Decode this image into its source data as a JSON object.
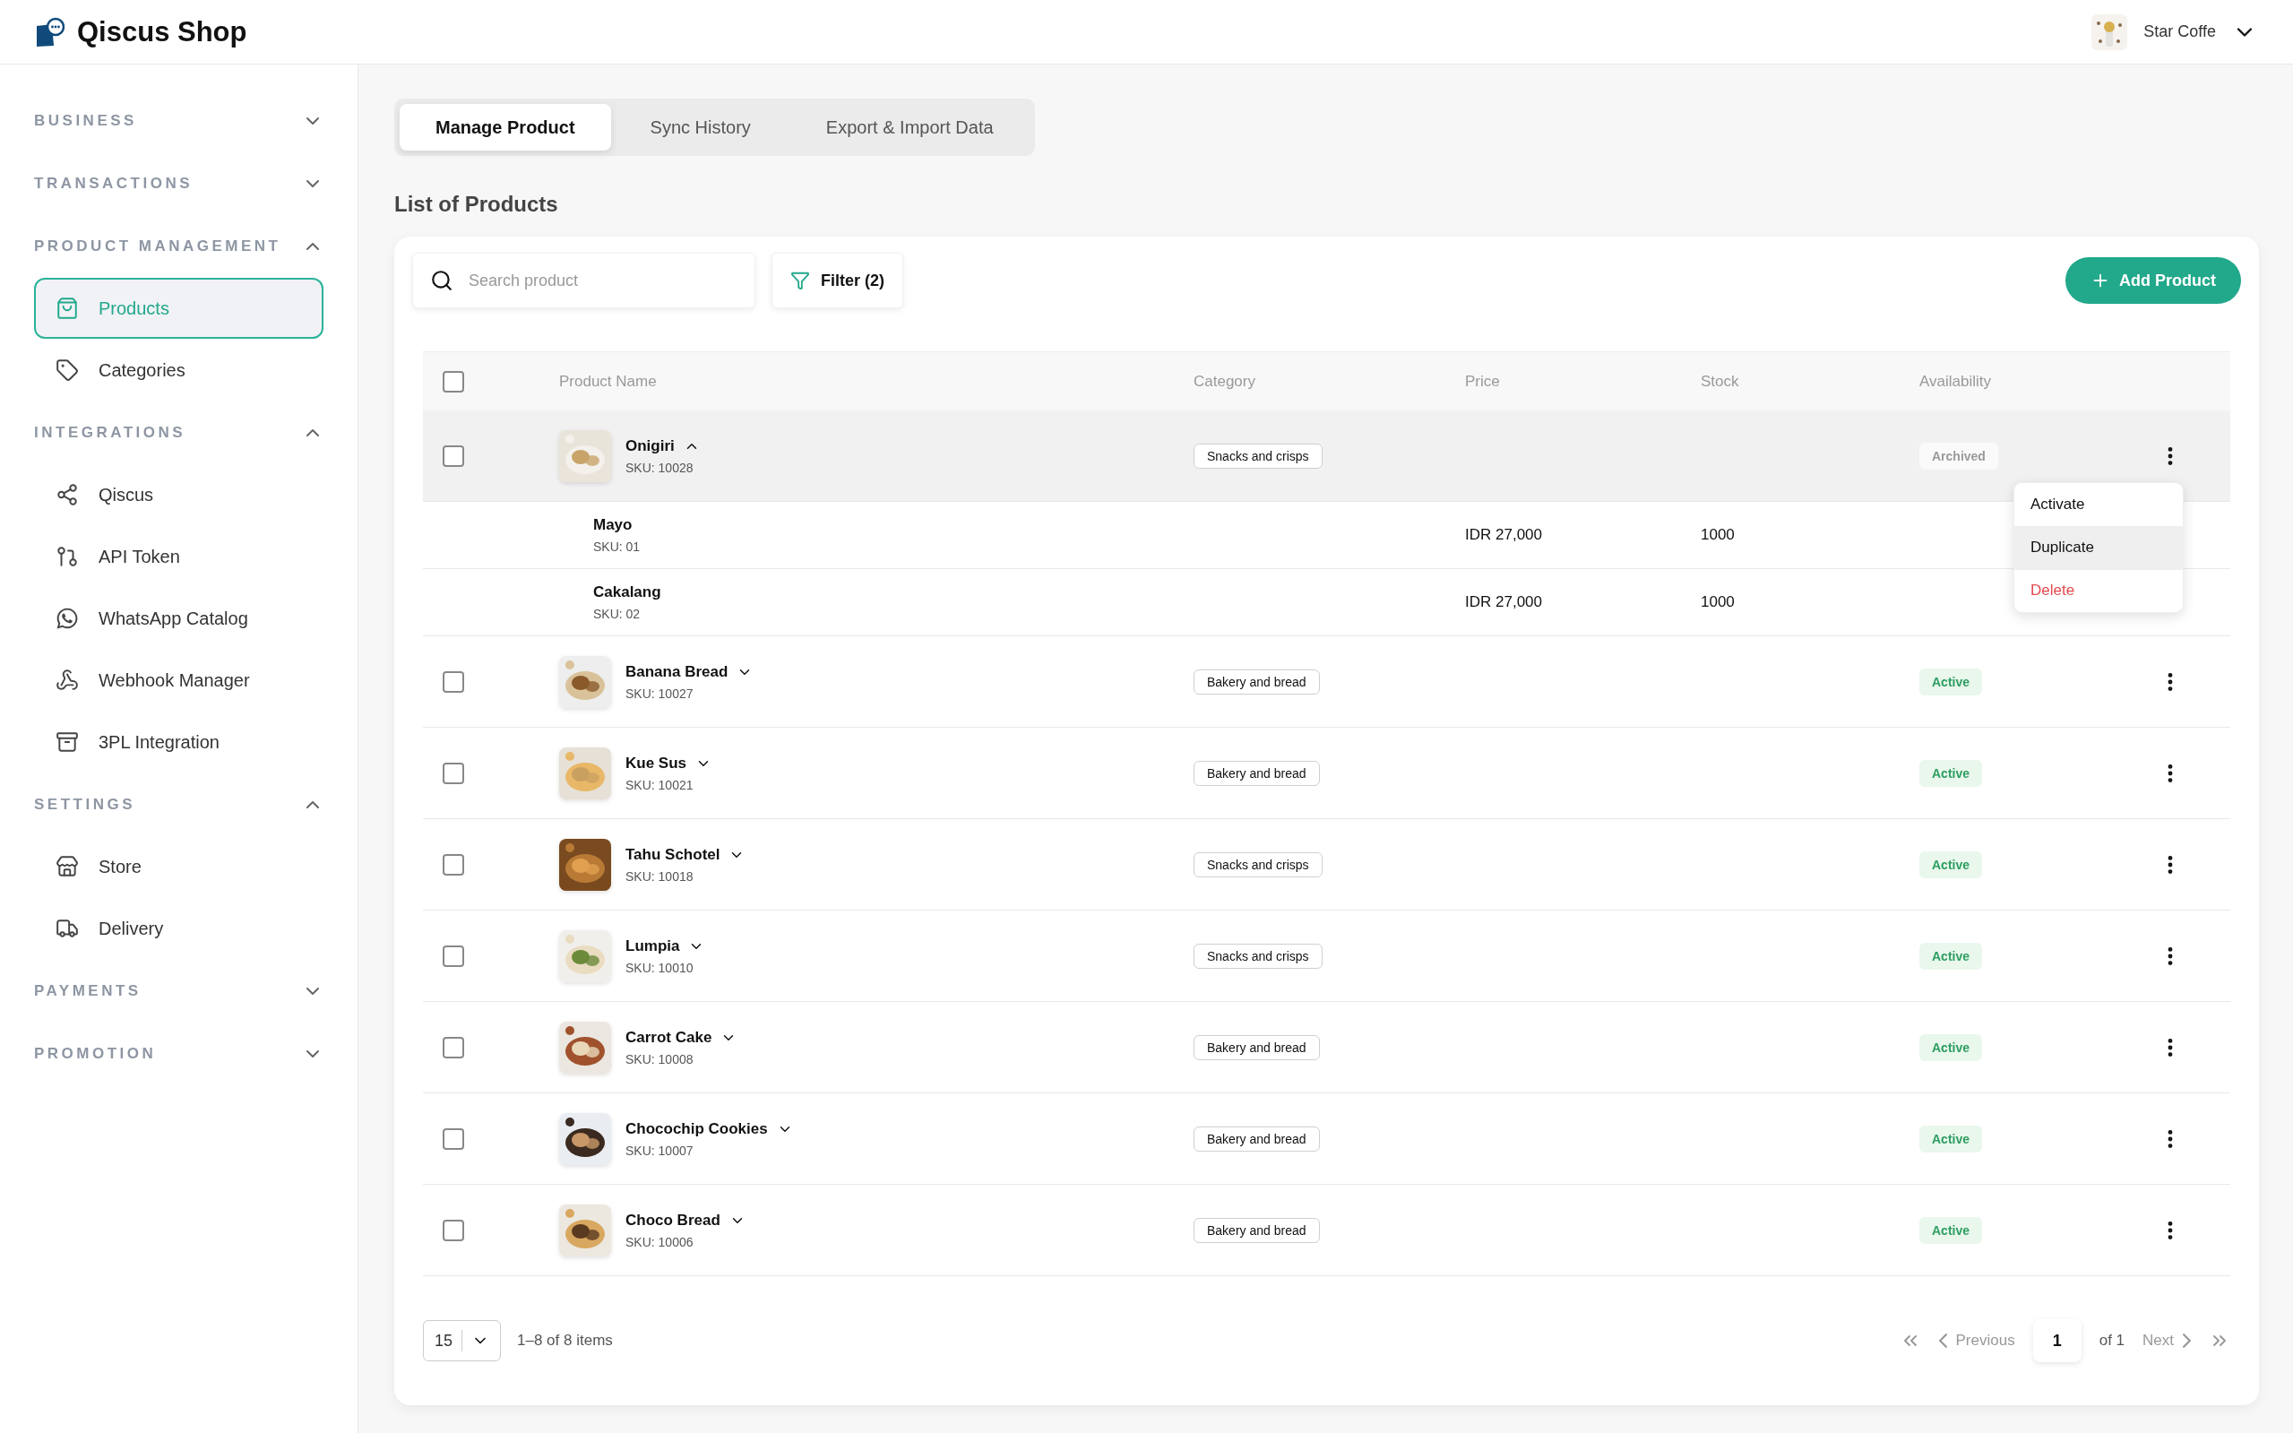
{
  "app": {
    "name": "Qiscus Shop"
  },
  "account": {
    "name": "Star Coffe"
  },
  "sidebar": {
    "sections": [
      {
        "title": "BUSINESS",
        "expanded": false
      },
      {
        "title": "TRANSACTIONS",
        "expanded": false
      },
      {
        "title": "PRODUCT MANAGEMENT",
        "expanded": true,
        "items": [
          {
            "label": "Products",
            "selected": true
          },
          {
            "label": "Categories",
            "selected": false
          }
        ]
      },
      {
        "title": "INTEGRATIONS",
        "expanded": true,
        "items": [
          {
            "label": "Qiscus",
            "selected": false
          },
          {
            "label": "API Token",
            "selected": false
          },
          {
            "label": "WhatsApp Catalog",
            "selected": false
          },
          {
            "label": "Webhook Manager",
            "selected": false
          },
          {
            "label": "3PL Integration",
            "selected": false
          }
        ]
      },
      {
        "title": "SETTINGS",
        "expanded": true,
        "items": [
          {
            "label": "Store",
            "selected": false
          },
          {
            "label": "Delivery",
            "selected": false
          }
        ]
      },
      {
        "title": "PAYMENTS",
        "expanded": false
      },
      {
        "title": "PROMOTION",
        "expanded": false
      }
    ]
  },
  "tabs": [
    {
      "label": "Manage Product",
      "selected": true
    },
    {
      "label": "Sync History",
      "selected": false
    },
    {
      "label": "Export & Import Data",
      "selected": false
    }
  ],
  "list_title": "List of Products",
  "search": {
    "placeholder": "Search product"
  },
  "filter_button": "Filter (2)",
  "add_button": "Add Product",
  "table": {
    "columns": [
      "Product Name",
      "Category",
      "Price",
      "Stock",
      "Availability"
    ],
    "header_checked": false,
    "rows": [
      {
        "name": "Onigiri",
        "sku": "SKU: 10028",
        "category": "Snacks and crisps",
        "availability": "Archived",
        "kind": "archived",
        "expanded": true,
        "checked": false,
        "highlighted": true,
        "variants": [
          {
            "name": "Mayo",
            "sku": "SKU: 01",
            "price": "IDR 27,000",
            "stock": "1000"
          },
          {
            "name": "Cakalang",
            "sku": "SKU: 02",
            "price": "IDR 27,000",
            "stock": "1000"
          }
        ],
        "menu": [
          {
            "label": "Activate",
            "kind": "normal",
            "highlighted": false
          },
          {
            "label": "Duplicate",
            "kind": "normal",
            "highlighted": true
          },
          {
            "label": "Delete",
            "kind": "danger",
            "highlighted": false
          }
        ]
      },
      {
        "name": "Banana Bread",
        "sku": "SKU: 10027",
        "category": "Bakery and bread",
        "availability": "Active",
        "kind": "active",
        "expanded": false,
        "checked": false,
        "highlighted": false
      },
      {
        "name": "Kue Sus",
        "sku": "SKU: 10021",
        "category": "Bakery and bread",
        "availability": "Active",
        "kind": "active",
        "expanded": false,
        "checked": false,
        "highlighted": false
      },
      {
        "name": "Tahu Schotel",
        "sku": "SKU: 10018",
        "category": "Snacks and crisps",
        "availability": "Active",
        "kind": "active",
        "expanded": false,
        "checked": false,
        "highlighted": false
      },
      {
        "name": "Lumpia",
        "sku": "SKU: 10010",
        "category": "Snacks and crisps",
        "availability": "Active",
        "kind": "active",
        "expanded": false,
        "checked": false,
        "highlighted": false
      },
      {
        "name": "Carrot Cake",
        "sku": "SKU: 10008",
        "category": "Bakery and bread",
        "availability": "Active",
        "kind": "active",
        "expanded": false,
        "checked": false,
        "highlighted": false
      },
      {
        "name": "Chocochip Cookies",
        "sku": "SKU: 10007",
        "category": "Bakery and bread",
        "availability": "Active",
        "kind": "active",
        "expanded": false,
        "checked": false,
        "highlighted": false
      },
      {
        "name": "Choco Bread",
        "sku": "SKU: 10006",
        "category": "Bakery and bread",
        "availability": "Active",
        "kind": "active",
        "expanded": false,
        "checked": false,
        "highlighted": false
      }
    ]
  },
  "pagination": {
    "page_size": "15",
    "range": "1–8 of 8 items",
    "previous": "Previous",
    "previous_disabled": true,
    "page": "1",
    "of": "of 1",
    "next": "Next",
    "next_disabled": true
  }
}
